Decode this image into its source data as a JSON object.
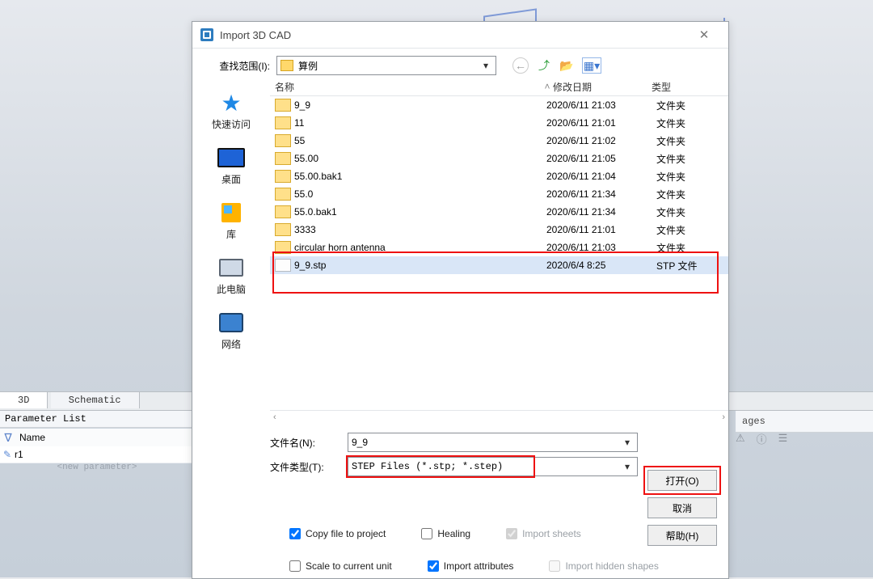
{
  "background": {
    "tabs": {
      "tab_3d": "3D",
      "tab_schematic": "Schematic"
    },
    "param_panel_title": "Parameter List",
    "param_header": "Name",
    "param_row": "r1",
    "param_new": "<new parameter>",
    "right_panel": "ages",
    "right_icons": {
      "warn": "⚠",
      "info": "ⓘ",
      "list": "☰"
    }
  },
  "dialog": {
    "title": "Import 3D CAD",
    "lookin_label": "查找范围(I):",
    "lookin_value": "算例",
    "nav": {
      "up_title": "Up",
      "new_title": "New Folder",
      "views_title": "Views"
    },
    "places": {
      "quick": "快速访问",
      "desktop": "桌面",
      "libs": "库",
      "thispc": "此电脑",
      "network": "网络"
    },
    "columns": {
      "name": "名称",
      "date": "修改日期",
      "type": "类型"
    },
    "files": [
      {
        "name": "9_9",
        "date": "2020/6/11 21:03",
        "type": "文件夹",
        "kind": "folder"
      },
      {
        "name": "11",
        "date": "2020/6/11 21:01",
        "type": "文件夹",
        "kind": "folder"
      },
      {
        "name": "55",
        "date": "2020/6/11 21:02",
        "type": "文件夹",
        "kind": "folder"
      },
      {
        "name": "55.00",
        "date": "2020/6/11 21:05",
        "type": "文件夹",
        "kind": "folder"
      },
      {
        "name": "55.00.bak1",
        "date": "2020/6/11 21:04",
        "type": "文件夹",
        "kind": "folder"
      },
      {
        "name": "55.0",
        "date": "2020/6/11 21:34",
        "type": "文件夹",
        "kind": "folder"
      },
      {
        "name": "55.0.bak1",
        "date": "2020/6/11 21:34",
        "type": "文件夹",
        "kind": "folder"
      },
      {
        "name": "3333",
        "date": "2020/6/11 21:01",
        "type": "文件夹",
        "kind": "folder"
      },
      {
        "name": "circular horn antenna",
        "date": "2020/6/11 21:03",
        "type": "文件夹",
        "kind": "folder"
      },
      {
        "name": "9_9.stp",
        "date": "2020/6/4 8:25",
        "type": "STP 文件",
        "kind": "file",
        "selected": true
      }
    ],
    "filename_label": "文件名(N):",
    "filename_value": "9_9",
    "filetype_label": "文件类型(T):",
    "filetype_value": "STEP Files (*.stp; *.step)",
    "buttons": {
      "open": "打开(O)",
      "cancel": "取消",
      "help": "帮助(H)"
    },
    "checks": {
      "copy": "Copy file to project",
      "heal": "Healing",
      "sheets": "Import sheets",
      "scale": "Scale to current unit",
      "attrs": "Import attributes",
      "hidden": "Import hidden shapes"
    }
  }
}
